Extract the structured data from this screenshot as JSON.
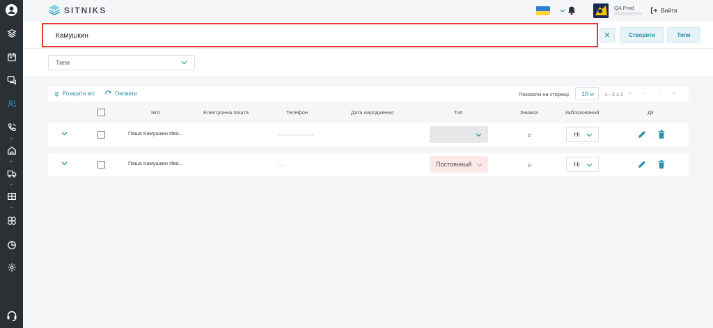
{
  "header": {
    "logo_text": "SITNIKS",
    "user_name": "QA Prod",
    "logout_label": "Вийти"
  },
  "search": {
    "value": "Камушкин",
    "create_label": "Створити",
    "types_label": "Типи"
  },
  "filter": {
    "type_placeholder": "Типи"
  },
  "toolbar": {
    "expand_all": "Розкрити всі",
    "refresh": "Оновити",
    "per_page_label": "Показати на сторінці",
    "per_page": "10",
    "range": "1 - 2 з 2"
  },
  "table": {
    "columns": [
      "Ім'я",
      "Електронна пошта",
      "Телефон",
      "Дата народження",
      "Тип",
      "Знижка",
      "Заблокований",
      "Дії"
    ],
    "rows": [
      {
        "name": "Паша Камушкин Ива...",
        "type": "",
        "discount": "0",
        "blocked": "Ні"
      },
      {
        "name": "Паша Камушкин Ива...",
        "type": "Постоянный",
        "discount": "0",
        "blocked": "Ні"
      }
    ]
  },
  "colors": {
    "accent": "#2a8fa8",
    "sidebar": "#2b3035",
    "highlight": "#e53935",
    "type_badge_bg": "#fbe9ea"
  }
}
